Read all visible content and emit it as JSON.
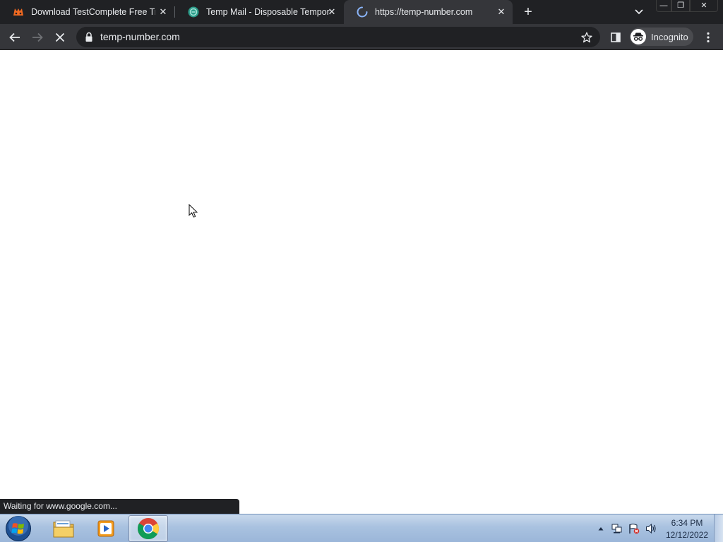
{
  "browser": {
    "tabs": [
      {
        "title": "Download TestComplete Free Trial",
        "favicon": "smartbear-icon",
        "close": "✕"
      },
      {
        "title": "Temp Mail - Disposable Temporary Email",
        "favicon": "tempmail-icon",
        "close": "✕"
      },
      {
        "title": "https://temp-number.com",
        "favicon": "loading-spinner-icon",
        "close": "✕",
        "active": true
      }
    ],
    "new_tab": "+",
    "window_controls": {
      "minimize": "—",
      "maximize": "❐",
      "close": "✕"
    },
    "address_bar": {
      "url": "temp-number.com",
      "secure": true
    },
    "profile": {
      "label": "Incognito",
      "icon": "incognito-icon"
    },
    "status_bubble": "Waiting for www.google.com..."
  },
  "colors": {
    "tabstrip": "#202124",
    "toolbar": "#35363a",
    "omnibox": "#202124",
    "page": "#ffffff"
  },
  "taskbar": {
    "pinned": [
      "windows-explorer-icon",
      "media-player-icon",
      "chrome-icon"
    ],
    "active_app": "chrome-icon",
    "clock": {
      "time": "6:34 PM",
      "date": "12/12/2022"
    },
    "tray": [
      "show-hidden-icons-arrow",
      "network-icon",
      "action-center-flag-icon",
      "volume-icon"
    ]
  }
}
